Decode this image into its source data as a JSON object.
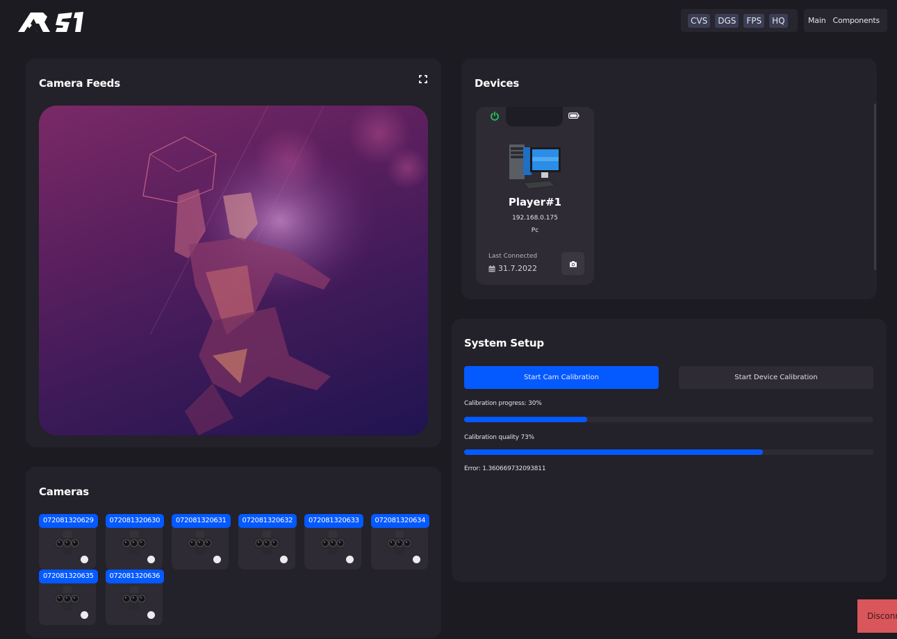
{
  "header": {
    "logo_text": "AR 51",
    "tags": [
      "CVS",
      "DGS",
      "FPS",
      "HQ"
    ],
    "nav": [
      "Main",
      "Components"
    ]
  },
  "camera_feeds": {
    "title": "Camera Feeds",
    "expand_icon": "fullscreen-icon",
    "feed_description": "low-poly basketball player dunking"
  },
  "devices": {
    "title": "Devices",
    "items": [
      {
        "name": "Player#1",
        "ip": "192.168.0.175",
        "type": "Pc",
        "last_connected_label": "Last Connected",
        "last_connected_date": "31.7.2022",
        "power_status": "on",
        "power_color": "#22c55e"
      }
    ]
  },
  "system_setup": {
    "title": "System Setup",
    "start_cam_calibration": "Start Cam Calibration",
    "start_device_calibration": "Start Device Calibration",
    "calibration_progress_label": "Calibration progress: 30%",
    "calibration_progress": 30,
    "calibration_quality_label": "Calibration quality 73%",
    "calibration_quality": 73,
    "error_label": "Error: 1.360669732093811"
  },
  "cameras": {
    "title": "Cameras",
    "items": [
      {
        "serial": "072081320629"
      },
      {
        "serial": "072081320630"
      },
      {
        "serial": "072081320631"
      },
      {
        "serial": "072081320632"
      },
      {
        "serial": "072081320633"
      },
      {
        "serial": "072081320634"
      },
      {
        "serial": "072081320635"
      },
      {
        "serial": "072081320636"
      }
    ]
  },
  "disconnect_label": "Disconnect",
  "colors": {
    "accent": "#0459ff",
    "danger": "#d9565b",
    "panel": "#232129",
    "background": "#1c1b21"
  }
}
